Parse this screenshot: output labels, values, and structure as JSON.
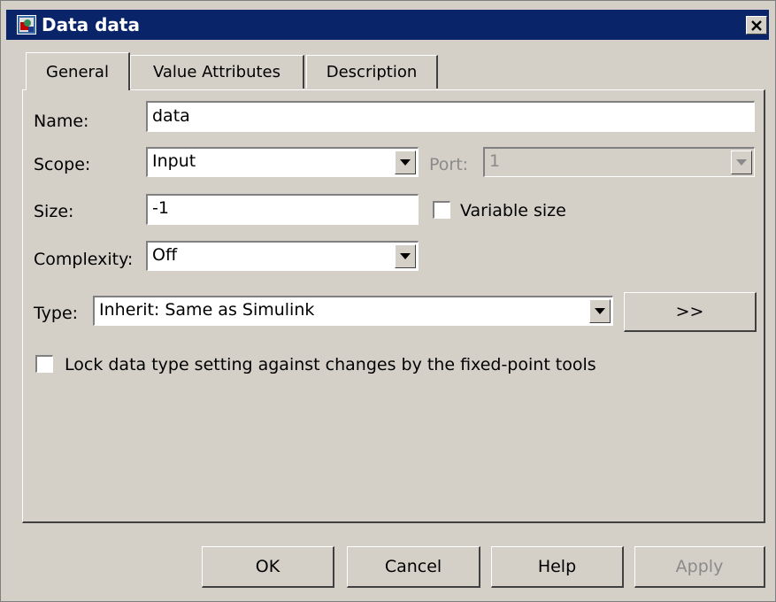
{
  "window": {
    "title": "Data data",
    "icon": "simulink-block-icon",
    "close_icon": "close-icon"
  },
  "tabs": [
    {
      "label": "General",
      "active": true
    },
    {
      "label": "Value Attributes",
      "active": false
    },
    {
      "label": "Description",
      "active": false
    }
  ],
  "form": {
    "name_label": "Name:",
    "name_value": "data",
    "scope_label": "Scope:",
    "scope_value": "Input",
    "port_label": "Port:",
    "port_value": "1",
    "size_label": "Size:",
    "size_value": "-1",
    "variable_size_label": "Variable size",
    "variable_size_checked": false,
    "complexity_label": "Complexity:",
    "complexity_value": "Off",
    "type_label": "Type:",
    "type_value": "Inherit: Same as Simulink",
    "type_assistant_label": ">>",
    "lock_label": "Lock data type setting against changes by the fixed-point tools",
    "lock_checked": false
  },
  "buttons": {
    "ok": "OK",
    "cancel": "Cancel",
    "help": "Help",
    "apply": "Apply"
  },
  "colors": {
    "titlebar": "#0a246a",
    "face": "#d4d0c8",
    "disabled_text": "#8a8a8a"
  }
}
